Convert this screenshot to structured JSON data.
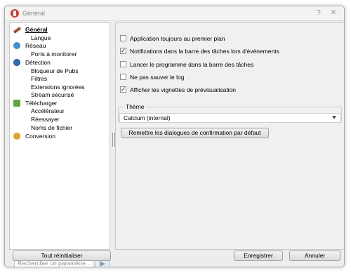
{
  "window": {
    "title": "Général",
    "help_glyph": "?",
    "close_glyph": "✕"
  },
  "sidebar": {
    "items": [
      {
        "label": "Général",
        "icon": "settings-icon",
        "selected": true
      },
      {
        "label": "Langue"
      },
      {
        "label": "Réseau",
        "icon": "network-icon"
      },
      {
        "label": "Ports à monitorer"
      },
      {
        "label": "Détection",
        "icon": "detection-icon"
      },
      {
        "label": "Bloqueur de Pubs"
      },
      {
        "label": "Filtres"
      },
      {
        "label": "Extensions ignorées"
      },
      {
        "label": "Stream sécurisé"
      },
      {
        "label": "Télécharger",
        "icon": "download-icon"
      },
      {
        "label": "Accélérateur"
      },
      {
        "label": "Réessayer"
      },
      {
        "label": "Noms de fichier"
      },
      {
        "label": "Conversion",
        "icon": "conversion-icon"
      }
    ],
    "search_placeholder": "Rechercher un paramètre..."
  },
  "options": [
    {
      "label": "Application toujours au premier plan",
      "checked": false
    },
    {
      "label": "Notifications dans la barre des tâches lors d'événements",
      "checked": true
    },
    {
      "label": "Lancer le programme dans la barre des tâches",
      "checked": false
    },
    {
      "label": "Ne pas sauver le log",
      "checked": false
    },
    {
      "label": "Afficher les vignettes de prévisualisation",
      "checked": true
    }
  ],
  "theme": {
    "label": "Thème",
    "value": "Calcium (internal)"
  },
  "buttons": {
    "reset_dialogs": "Remettre les dialogues de confirmation par défaut",
    "reset_all": "Tout réinitialiser",
    "save": "Enregistrer",
    "cancel": "Annuler"
  },
  "check_glyph": "✓"
}
